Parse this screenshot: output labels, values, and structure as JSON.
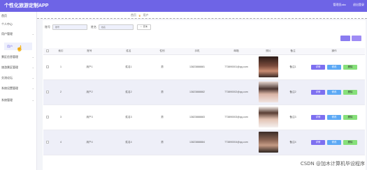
{
  "header": {
    "app_title": "个性化旅游定制APP",
    "admin": "管理员abc",
    "logout": "退出登录"
  },
  "sidebar": {
    "items": [
      {
        "label": "首页"
      },
      {
        "label": "个人中心"
      },
      {
        "label": "用户管理"
      },
      {
        "label": "景区信息管理"
      },
      {
        "label": "旅游景区管理"
      },
      {
        "label": "交流论坛"
      },
      {
        "label": "系统设置管理"
      },
      {
        "label": "系统管理"
      }
    ],
    "sub_item": "用户"
  },
  "breadcrumb": {
    "home": "首页",
    "current": "用户"
  },
  "search": {
    "account_label": "账号",
    "account_placeholder": "账号",
    "name_label": "姓名",
    "name_placeholder": "姓名",
    "button_label": "查询"
  },
  "table": {
    "headers": [
      "",
      "索引",
      "账号",
      "姓名",
      "性别",
      "手机",
      "邮箱",
      "照片",
      "备注",
      "操作"
    ],
    "rows": [
      {
        "index": "1",
        "account": "用户1",
        "name": "姓名1",
        "gender": "男",
        "phone": "13823888881",
        "email": "773890001@qq.com",
        "remark": "备注1",
        "photo_color": "#3a2a26"
      },
      {
        "index": "2",
        "account": "用户2",
        "name": "姓名2",
        "gender": "男",
        "phone": "13823888882",
        "email": "773890002@qq.com",
        "remark": "备注2",
        "photo_color": "#c9a9a0"
      },
      {
        "index": "3",
        "account": "用户3",
        "name": "姓名3",
        "gender": "男",
        "phone": "13823888883",
        "email": "773890003@qq.com",
        "remark": "备注3",
        "photo_color": "#b89a86"
      },
      {
        "index": "4",
        "account": "用户4",
        "name": "姓名4",
        "gender": "男",
        "phone": "13823888884",
        "email": "773890004@qq.com",
        "remark": "备注4",
        "photo_color": "#5a4238"
      }
    ],
    "ops": {
      "detail": "详情",
      "edit": "修改",
      "delete": "删除"
    }
  },
  "watermark": "CSDN @加木计算机毕设程序",
  "colors": {
    "accent": "#6e64e6"
  }
}
